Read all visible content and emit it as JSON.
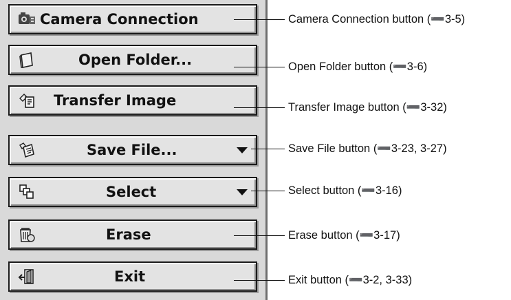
{
  "buttons": [
    {
      "id": "camera-connection",
      "label": "Camera Connection",
      "icon": "camera-connection-icon",
      "has_dropdown": false
    },
    {
      "id": "open-folder",
      "label": "Open Folder...",
      "icon": "folder-icon",
      "has_dropdown": false
    },
    {
      "id": "transfer-image",
      "label": "Transfer Image",
      "icon": "transfer-image-icon",
      "has_dropdown": false
    },
    {
      "id": "save-file",
      "label": "Save File...",
      "icon": "save-file-icon",
      "has_dropdown": true
    },
    {
      "id": "select",
      "label": "Select",
      "icon": "select-icon",
      "has_dropdown": true
    },
    {
      "id": "erase",
      "label": "Erase",
      "icon": "erase-icon",
      "has_dropdown": false
    },
    {
      "id": "exit",
      "label": "Exit",
      "icon": "exit-icon",
      "has_dropdown": false
    }
  ],
  "callouts": [
    "Camera Connection button (➖3-5)",
    "Open Folder button (➖3-6)",
    "Transfer Image button (➖3-32)",
    "Save File button (➖3-23, 3-27)",
    "Select button (➖3-16)",
    "Erase button (➖3-17)",
    "Exit button (➖3-2, 3-33)"
  ],
  "colors": {
    "panel_background": "#d9d9d9",
    "button_face": "#e3e3e3",
    "text": "#111111"
  }
}
